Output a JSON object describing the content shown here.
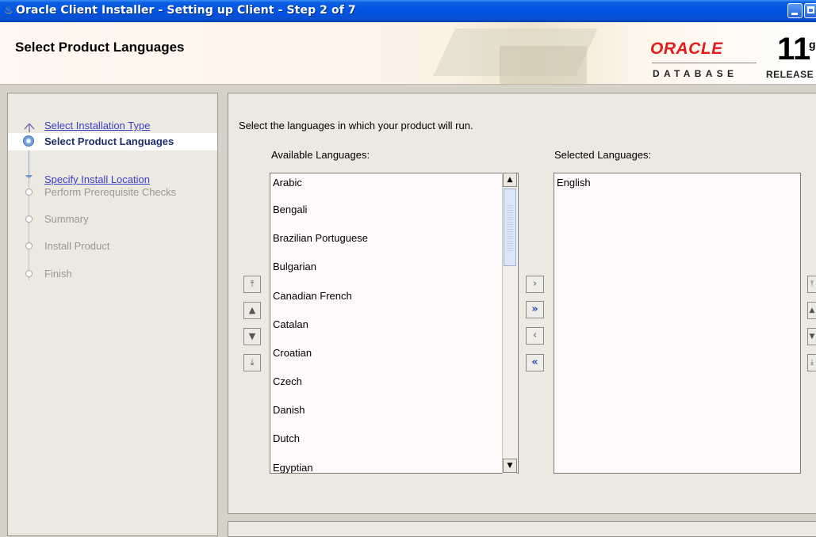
{
  "window": {
    "title": "Oracle Client Installer - Setting up Client - Step 2 of 7",
    "app_icon": "java-cup-icon"
  },
  "header": {
    "page_title": "Select Product Languages",
    "brand_name": "ORACLE",
    "brand_product": "DATABASE",
    "version_number": "11",
    "version_suffix": "g",
    "release_label": "RELEASE"
  },
  "steps": [
    {
      "label": "Select Installation Type",
      "state": "done-link"
    },
    {
      "label": "Select Product Languages",
      "state": "current"
    },
    {
      "label": "Specify Install Location",
      "state": "done-link"
    },
    {
      "label": "Perform Prerequisite Checks",
      "state": "pending"
    },
    {
      "label": "Summary",
      "state": "pending"
    },
    {
      "label": "Install Product",
      "state": "pending"
    },
    {
      "label": "Finish",
      "state": "pending"
    }
  ],
  "content": {
    "instruction": "Select the languages in which your product will run.",
    "available_label": "Available Languages:",
    "selected_label": "Selected Languages:",
    "available_languages": [
      "Arabic",
      "Bengali",
      "Brazilian Portuguese",
      "Bulgarian",
      "Canadian French",
      "Catalan",
      "Croatian",
      "Czech",
      "Danish",
      "Dutch",
      "Egyptian"
    ],
    "selected_languages": [
      "English"
    ]
  },
  "controls": {
    "move_top_icon": "move-top-icon",
    "move_up_icon": "move-up-icon",
    "move_down_icon": "move-down-icon",
    "move_bottom_icon": "move-bottom-icon",
    "add_icon": "add-icon",
    "add_all_icon": "add-all-icon",
    "remove_icon": "remove-icon",
    "remove_all_icon": "remove-all-icon"
  },
  "colors": {
    "titlebar": "#0054e3",
    "link": "#3b3dc8",
    "brand_red": "#e01c1c"
  }
}
